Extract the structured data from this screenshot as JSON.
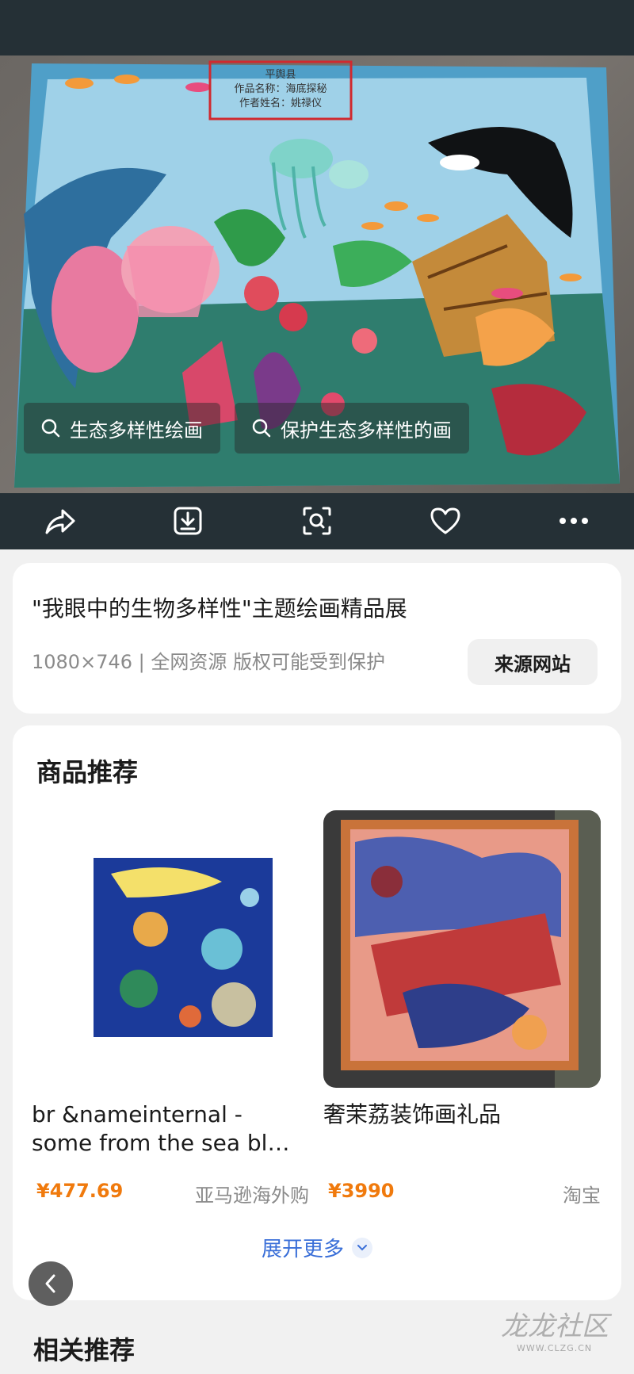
{
  "image_viewer": {
    "painting_label": {
      "line1": "平舆县",
      "line2": "作品名称：海底探秘",
      "line3": "作者姓名：姚禄仪"
    },
    "search_chips": [
      {
        "label": "生态多样性绘画",
        "icon": "search-icon"
      },
      {
        "label": "保护生态多样性的画",
        "icon": "search-icon"
      }
    ],
    "actions": [
      {
        "name": "share",
        "icon": "share-icon"
      },
      {
        "name": "download",
        "icon": "download-icon"
      },
      {
        "name": "visual-search",
        "icon": "scan-icon"
      },
      {
        "name": "favorite",
        "icon": "heart-icon"
      },
      {
        "name": "more",
        "icon": "more-icon"
      }
    ]
  },
  "info": {
    "title": "\"我眼中的生物多样性\"主题绘画精品展",
    "meta": "1080×746 | 全网资源 版权可能受到保护",
    "source_button": "来源网站"
  },
  "goods": {
    "section_title": "商品推荐",
    "products": [
      {
        "name": "br &nameinternal - some from the sea bl…",
        "price": "¥477.69",
        "shop": "亚马逊海外购"
      },
      {
        "name": "奢茉荔装饰画礼品",
        "price": "¥3990",
        "shop": "淘宝"
      }
    ],
    "expand_label": "展开更多"
  },
  "related": {
    "title": "相关推荐"
  },
  "watermark": {
    "text": "龙龙社区",
    "subtext": "WWW.CLZG.CN"
  },
  "colors": {
    "accent_price": "#f07a0d",
    "link": "#3a6fd8",
    "dark_bg": "#253036"
  }
}
